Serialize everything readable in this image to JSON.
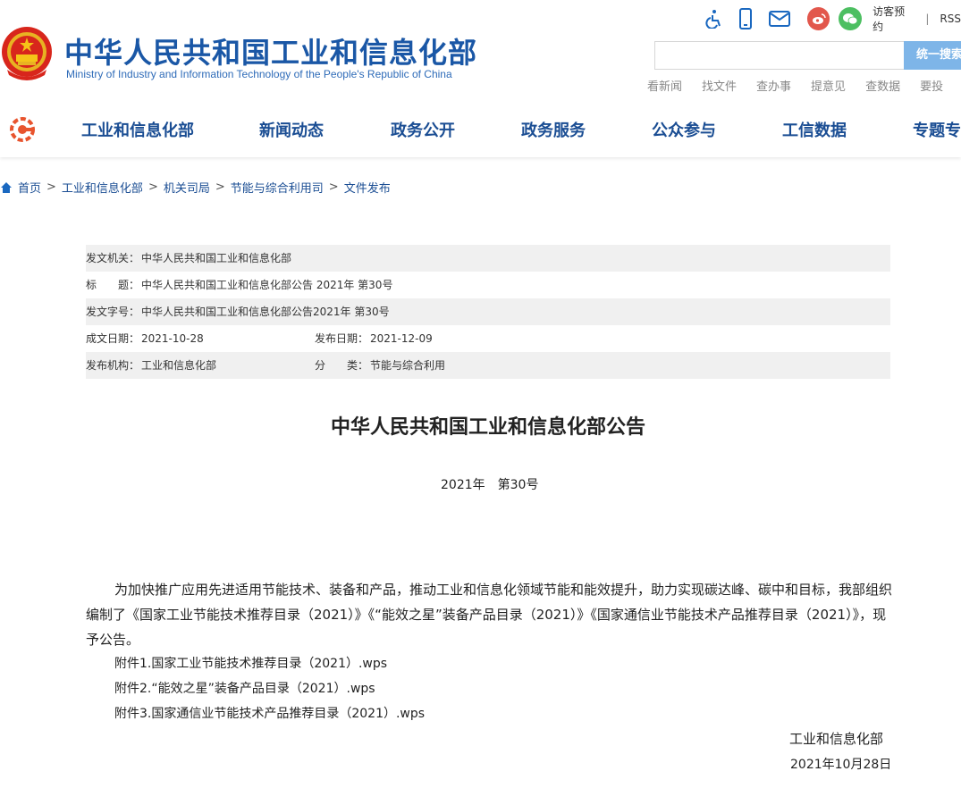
{
  "header": {
    "site_title": "中华人民共和国工业和信息化部",
    "site_subtitle": "Ministry of Industry and Information Technology of the People's Republic of China",
    "top_icons": [
      "accessibility-icon",
      "mobile-icon",
      "mail-icon",
      "weibo-icon",
      "wechat-icon"
    ],
    "visitor_link": "访客预约",
    "separator": "|",
    "rss_link": "RSS",
    "search": {
      "placeholder": "",
      "button_label": "统一搜索"
    },
    "quick_links": [
      "看新闻",
      "找文件",
      "查办事",
      "提意见",
      "查数据",
      "要投"
    ]
  },
  "nav": {
    "items": [
      "工业和信息化部",
      "新闻动态",
      "政务公开",
      "政务服务",
      "公众参与",
      "工信数据",
      "专题专"
    ]
  },
  "breadcrumb": {
    "items": [
      "首页",
      "工业和信息化部",
      "机关司局",
      "节能与综合利用司",
      "文件发布"
    ],
    "separator": ">"
  },
  "info": {
    "issuer_label": "发文机关：",
    "issuer_value": "中华人民共和国工业和信息化部",
    "title_label": "标　　题：",
    "title_value": "中华人民共和国工业和信息化部公告 2021年 第30号",
    "docno_label": "发文字号：",
    "docno_value": "中华人民共和国工业和信息化部公告2021年 第30号",
    "written_label": "成文日期：",
    "written_value": "2021-10-28",
    "published_label": "发布日期：",
    "published_value": "2021-12-09",
    "org_label": "发布机构：",
    "org_value": "工业和信息化部",
    "category_label": "分　　类：",
    "category_value": "节能与综合利用"
  },
  "document": {
    "title": "中华人民共和国工业和信息化部公告",
    "number": "2021年　第30号",
    "body": "为加快推广应用先进适用节能技术、装备和产品，推动工业和信息化领域节能和能效提升，助力实现碳达峰、碳中和目标，我部组织编制了《国家工业节能技术推荐目录（2021）》《“能效之星”装备产品目录（2021）》《国家通信业节能技术产品推荐目录（2021）》，现予公告。",
    "attachments": [
      "附件1.国家工业节能技术推荐目录（2021）.wps",
      "附件2.“能效之星”装备产品目录（2021）.wps",
      "附件3.国家通信业节能技术产品推荐目录（2021）.wps"
    ],
    "signature_org": "工业和信息化部",
    "signature_date": "2021年10月28日"
  }
}
